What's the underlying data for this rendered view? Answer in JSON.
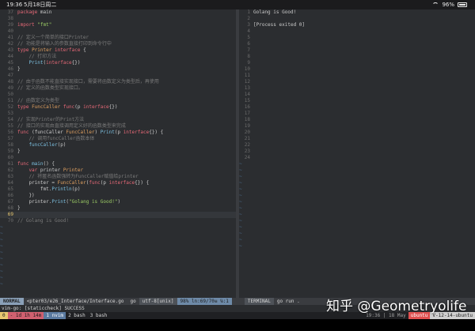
{
  "device_status": {
    "time": "19:36",
    "date": "5月18日周二",
    "battery": "96%"
  },
  "editor": {
    "lines": [
      {
        "n": "37",
        "tokens": [
          {
            "c": "kw",
            "t": "package "
          },
          {
            "c": "",
            "t": "main"
          }
        ]
      },
      {
        "n": "38",
        "tokens": []
      },
      {
        "n": "39",
        "tokens": [
          {
            "c": "kw",
            "t": "import "
          },
          {
            "c": "str",
            "t": "\"fmt\""
          }
        ]
      },
      {
        "n": "40",
        "tokens": []
      },
      {
        "n": "41",
        "tokens": [
          {
            "c": "cm",
            "t": "// 定义一个简单的接口Printer"
          }
        ]
      },
      {
        "n": "42",
        "tokens": [
          {
            "c": "cm",
            "t": "// 功能是将输入的参数直接打印到命令行中"
          }
        ]
      },
      {
        "n": "43",
        "tokens": [
          {
            "c": "kw",
            "t": "type "
          },
          {
            "c": "ty",
            "t": "Printer "
          },
          {
            "c": "kw",
            "t": "interface "
          },
          {
            "c": "",
            "t": "{"
          }
        ]
      },
      {
        "n": "44",
        "tokens": [
          {
            "c": "cm",
            "t": "    // 打印方法"
          }
        ]
      },
      {
        "n": "45",
        "tokens": [
          {
            "c": "fn",
            "t": "    Print"
          },
          {
            "c": "",
            "t": "("
          },
          {
            "c": "kw",
            "t": "interface"
          },
          {
            "c": "",
            "t": "{})"
          }
        ]
      },
      {
        "n": "46",
        "tokens": [
          {
            "c": "",
            "t": "}"
          }
        ]
      },
      {
        "n": "47",
        "tokens": []
      },
      {
        "n": "48",
        "tokens": [
          {
            "c": "cm",
            "t": "// 由于函数不能直接实现接口，需要将函数定义为类型后，再使用"
          }
        ]
      },
      {
        "n": "49",
        "tokens": [
          {
            "c": "cm",
            "t": "// 定义的函数类型实现接口。"
          }
        ]
      },
      {
        "n": "50",
        "tokens": []
      },
      {
        "n": "51",
        "tokens": [
          {
            "c": "cm",
            "t": "// 函数定义为类型"
          }
        ]
      },
      {
        "n": "52",
        "tokens": [
          {
            "c": "kw",
            "t": "type "
          },
          {
            "c": "ty",
            "t": "FuncCaller "
          },
          {
            "c": "kw",
            "t": "func"
          },
          {
            "c": "",
            "t": "(p "
          },
          {
            "c": "kw",
            "t": "interface"
          },
          {
            "c": "",
            "t": "{})"
          }
        ]
      },
      {
        "n": "53",
        "tokens": []
      },
      {
        "n": "54",
        "tokens": [
          {
            "c": "cm",
            "t": "// 实现Printer的Print方法"
          }
        ]
      },
      {
        "n": "55",
        "tokens": [
          {
            "c": "cm",
            "t": "// 接口的实现由直接调用定义好的函数类型来完成"
          }
        ]
      },
      {
        "n": "56",
        "tokens": [
          {
            "c": "kw",
            "t": "func "
          },
          {
            "c": "",
            "t": "(funcCaller "
          },
          {
            "c": "ty",
            "t": "FuncCaller"
          },
          {
            "c": "",
            "t": ") "
          },
          {
            "c": "fn",
            "t": "Print"
          },
          {
            "c": "",
            "t": "(p "
          },
          {
            "c": "kw",
            "t": "interface"
          },
          {
            "c": "",
            "t": "{}) {"
          }
        ]
      },
      {
        "n": "57",
        "tokens": [
          {
            "c": "cm",
            "t": "    // 调用funcCaller函数本体"
          }
        ]
      },
      {
        "n": "58",
        "tokens": [
          {
            "c": "fn",
            "t": "    funcCaller"
          },
          {
            "c": "",
            "t": "(p)"
          }
        ]
      },
      {
        "n": "59",
        "tokens": [
          {
            "c": "",
            "t": "}"
          }
        ]
      },
      {
        "n": "60",
        "tokens": []
      },
      {
        "n": "61",
        "tokens": [
          {
            "c": "kw",
            "t": "func "
          },
          {
            "c": "fn",
            "t": "main"
          },
          {
            "c": "",
            "t": "() {"
          }
        ]
      },
      {
        "n": "62",
        "tokens": [
          {
            "c": "kw",
            "t": "    var "
          },
          {
            "c": "",
            "t": "printer "
          },
          {
            "c": "ty",
            "t": "Printer"
          }
        ]
      },
      {
        "n": "63",
        "tokens": [
          {
            "c": "cm",
            "t": "    // 将匿名函数强转为FuncCaller赋值给printer"
          }
        ]
      },
      {
        "n": "64",
        "tokens": [
          {
            "c": "",
            "t": "    printer = "
          },
          {
            "c": "ty",
            "t": "FuncCaller"
          },
          {
            "c": "",
            "t": "("
          },
          {
            "c": "kw",
            "t": "func"
          },
          {
            "c": "",
            "t": "(p "
          },
          {
            "c": "kw",
            "t": "interface"
          },
          {
            "c": "",
            "t": "{}) {"
          }
        ]
      },
      {
        "n": "65",
        "tokens": [
          {
            "c": "",
            "t": "        fmt."
          },
          {
            "c": "fn",
            "t": "Println"
          },
          {
            "c": "",
            "t": "(p)"
          }
        ]
      },
      {
        "n": "66",
        "tokens": [
          {
            "c": "",
            "t": "    })"
          }
        ]
      },
      {
        "n": "67",
        "tokens": [
          {
            "c": "",
            "t": "    printer."
          },
          {
            "c": "fn",
            "t": "Print"
          },
          {
            "c": "",
            "t": "("
          },
          {
            "c": "str",
            "t": "\"Golang is Good!\""
          },
          {
            "c": "",
            "t": ")"
          }
        ]
      },
      {
        "n": "68",
        "tokens": [
          {
            "c": "",
            "t": "}"
          }
        ]
      },
      {
        "n": "69",
        "tokens": [],
        "current": true
      },
      {
        "n": "70",
        "tokens": [
          {
            "c": "cm",
            "t": "// Golang is Good!"
          }
        ]
      }
    ],
    "tilde_count": 10
  },
  "terminal": {
    "lines": [
      {
        "n": "1",
        "text": "Golang is Good!"
      },
      {
        "n": "2",
        "text": ""
      },
      {
        "n": "3",
        "text": "[Process exited 0]"
      },
      {
        "n": "4",
        "text": ""
      },
      {
        "n": "5",
        "text": ""
      },
      {
        "n": "6",
        "text": ""
      },
      {
        "n": "7",
        "text": ""
      },
      {
        "n": "8",
        "text": ""
      },
      {
        "n": "9",
        "text": ""
      },
      {
        "n": "10",
        "text": ""
      },
      {
        "n": "11",
        "text": ""
      },
      {
        "n": "12",
        "text": ""
      },
      {
        "n": "13",
        "text": ""
      },
      {
        "n": "14",
        "text": ""
      },
      {
        "n": "15",
        "text": ""
      },
      {
        "n": "16",
        "text": ""
      },
      {
        "n": "17",
        "text": ""
      },
      {
        "n": "18",
        "text": ""
      },
      {
        "n": "19",
        "text": ""
      },
      {
        "n": "20",
        "text": ""
      },
      {
        "n": "21",
        "text": ""
      },
      {
        "n": "22",
        "text": ""
      },
      {
        "n": "23",
        "text": ""
      },
      {
        "n": "24",
        "text": ""
      }
    ],
    "tilde_count": 14
  },
  "vim_status": {
    "mode": "NORMAL",
    "file": "<pter03/e26_Interface/Interface.go",
    "filetype": "go",
    "encoding": "utf-8[unix]",
    "position": "98% ln:69/70≡ ℅:1",
    "term_mode": "TERMINAL",
    "term_cmd": "go run ."
  },
  "cmdline": "vim-go: [staticcheck] SUCCESS",
  "tmux": {
    "session": "0",
    "status": "- 1d 1h 14m",
    "windows": [
      {
        "label": "1 nvim",
        "active": true
      },
      {
        "label": "2 bash",
        "active": false
      },
      {
        "label": "3 bash",
        "active": false
      }
    ],
    "right_time": "19:36 | 18 May",
    "host_left": "ubuntu",
    "host_right": "V-12-14-ubuntu"
  },
  "watermark": "知乎 @Geometryolife"
}
